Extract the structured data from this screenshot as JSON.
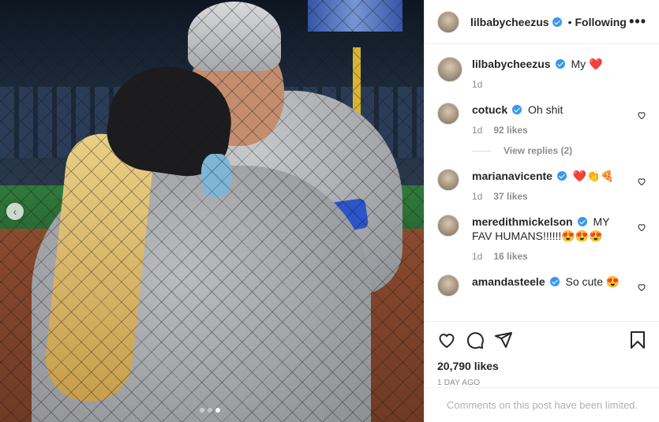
{
  "post": {
    "author": "lilbabycheezus",
    "follow_label": "Following",
    "separator": "•",
    "more_label": "•••",
    "caption_text": "My",
    "caption_emoji": "❤️",
    "caption_time": "1d"
  },
  "carousel": {
    "prev_label": "‹",
    "slide_count": 3,
    "active_slide": 3
  },
  "comments": [
    {
      "user": "cotuck",
      "text": "Oh shit",
      "time": "1d",
      "likes": "92 likes",
      "replies": "View replies (2)"
    },
    {
      "user": "marianavicente",
      "text": "❤️👏🍕",
      "time": "1d",
      "likes": "37 likes"
    },
    {
      "user": "meredithmickelson",
      "text": "MY FAV HUMANS!!!!!!😍😍😍",
      "time": "1d",
      "likes": "16 likes"
    },
    {
      "user": "amandasteele",
      "text": "So cute 😍"
    }
  ],
  "footer": {
    "likes_total": "20,790 likes",
    "time_ago": "1 DAY AGO",
    "comments_limited": "Comments on this post have been limited."
  },
  "icons": {
    "like": "heart-icon",
    "comment": "comment-icon",
    "share": "share-icon",
    "save": "bookmark-icon",
    "verified": "verified-badge-icon"
  },
  "colors": {
    "verified_blue": "#3897f0",
    "muted_text": "#8e8e8e",
    "border": "#efefef"
  }
}
